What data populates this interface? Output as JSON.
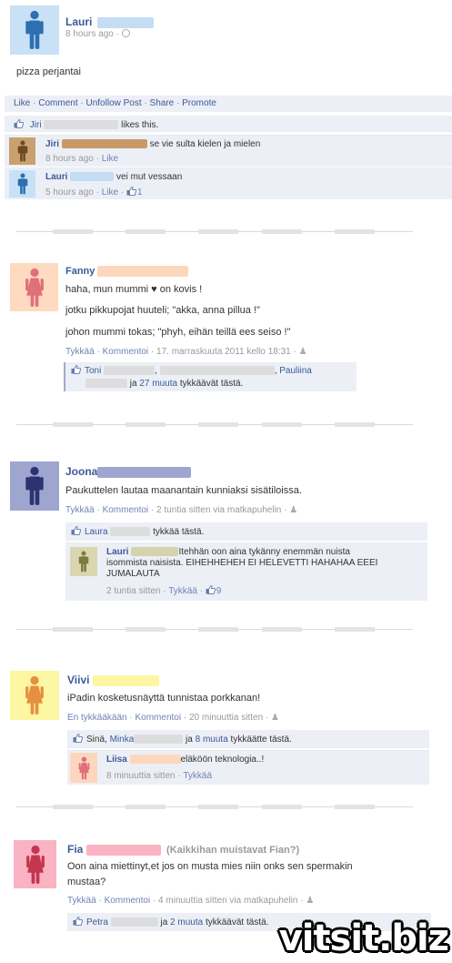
{
  "post1": {
    "author": "Lauri",
    "time": "8 hours ago",
    "text": "pizza perjantai",
    "actions": [
      "Like",
      "Comment",
      "Unfollow Post",
      "Share",
      "Promote"
    ],
    "likes_name": "Jiri",
    "likes_text": "likes this.",
    "comments": [
      {
        "author": "Jiri",
        "text": "se vie sulta kielen ja mielen",
        "time": "8 hours ago",
        "action": "Like"
      },
      {
        "author": "Lauri",
        "text": "vei mut vessaan",
        "time": "5 hours ago",
        "action": "Like",
        "likes": "1"
      }
    ]
  },
  "post2": {
    "author": "Fanny",
    "line1": "haha, mun mummi ♥ on kovis !",
    "line2": "jotku pikkupojat huuteli; \"akka, anna pillua !\"",
    "line3": "johon mummi tokas; \"phyh, eihän teillä ees seiso !\"",
    "like": "Tykkää",
    "comment": "Kommentoi",
    "time": "17. marraskuuta 2011 kello 18:31",
    "likes_name1": "Toni",
    "likes_sep": ",",
    "likes_name3": "Pauliina",
    "likes_and": "ja",
    "likes_more": "27 muuta",
    "likes_tail": "tykkäävät tästä."
  },
  "post3": {
    "author": "Joona",
    "text": "Paukuttelen lautaa maanantain kunniaksi sisätiloissa.",
    "like": "Tykkää",
    "comment": "Kommentoi",
    "time": "2 tuntia sitten via matkapuhelin",
    "likes_name": "Laura",
    "likes_tail": "tykkää tästä.",
    "c_author": "Lauri",
    "c_line1": "Itehhän oon aina tykänny enemmän nuista",
    "c_line2": "isommista naisista. EIHEHHEHEH EI HELEVETTI HAHAHAA EEEI",
    "c_line3": "JUMALAUTA",
    "c_time": "2 tuntia sitten",
    "c_action": "Tykkää",
    "c_likes": "9"
  },
  "post4": {
    "author": "Viivi",
    "text": "iPadin kosketusnäyttä tunnistaa porkkanan!",
    "like": "En tykkääkään",
    "comment": "Kommentoi",
    "time": "20 minuuttia sitten",
    "likes_you": "Sinä,",
    "likes_name": "Minka",
    "likes_and": "ja",
    "likes_more": "8 muuta",
    "likes_tail": "tykkäätte tästä.",
    "c_author": "Liisa",
    "c_text": "eläköön teknologia..!",
    "c_time": "8 minuuttia sitten",
    "c_action": "Tykkää"
  },
  "post5": {
    "author": "Fia",
    "note": "(Kaikkihan muistavat Fian?)",
    "line1": "Oon aina miettinyt,et jos on musta mies niin onks sen spermakin",
    "line2": "mustaa?",
    "like": "Tykkää",
    "comment": "Kommentoi",
    "time": "4 minuuttia sitten via matkapuhelin",
    "likes_name": "Petra",
    "likes_and": "ja",
    "likes_more": "2 muuta",
    "likes_tail": "tykkäävät tästä."
  },
  "watermark": "vitsit.biz",
  "colors": {
    "link": "#3b5998",
    "ufi_bg": "#eceff5",
    "male_blue": "#2d6fb0",
    "female_pink": "#e0707a",
    "orange": "#e59040",
    "olive": "#8c8a50",
    "brown": "#7a5a30"
  }
}
